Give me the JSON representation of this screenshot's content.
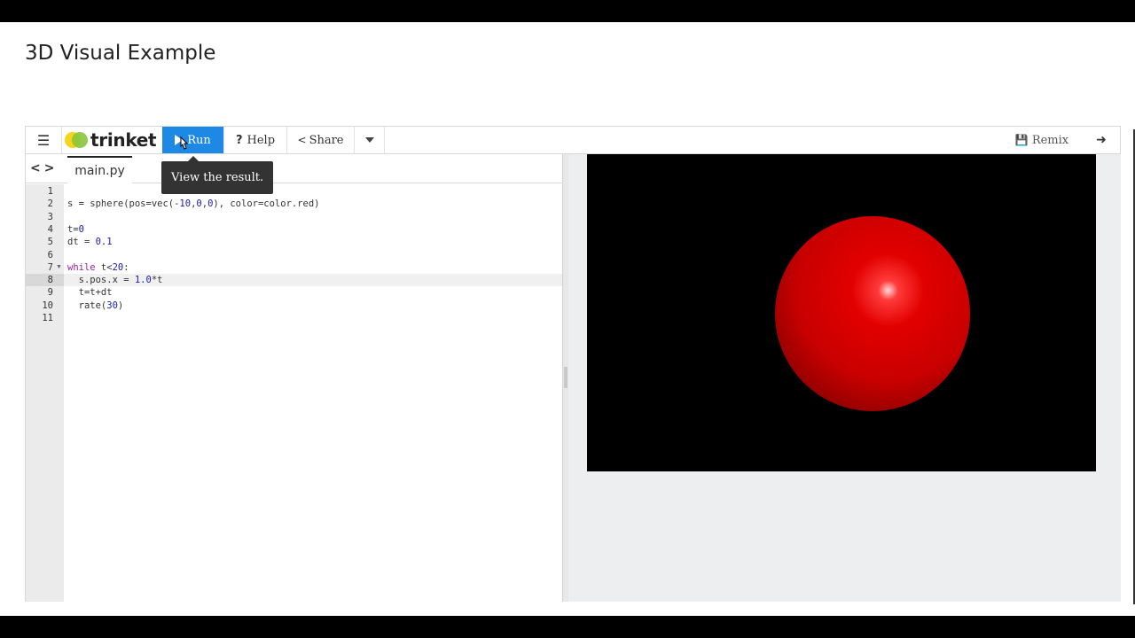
{
  "page": {
    "title": "3D Visual Example"
  },
  "toolbar": {
    "menu_icon": "hamburger-icon",
    "logo_text": "trinket",
    "run_label": "Run",
    "help_label": "Help",
    "share_label": "Share",
    "remix_label": "Remix",
    "run_color": "#1e88e5"
  },
  "tooltip": {
    "text": "View the result."
  },
  "editor": {
    "file_tab": "main.py",
    "active_line": 8,
    "lines": [
      {
        "n": "1",
        "text": ""
      },
      {
        "n": "2",
        "text": "s = sphere(pos=vec(-10,0,0), color=color.red)"
      },
      {
        "n": "3",
        "text": ""
      },
      {
        "n": "4",
        "text": "t=0"
      },
      {
        "n": "5",
        "text": "dt = 0.1"
      },
      {
        "n": "6",
        "text": ""
      },
      {
        "n": "7",
        "text": "while t<20:"
      },
      {
        "n": "8",
        "text": "  s.pos.x = 1.0*t"
      },
      {
        "n": "9",
        "text": "  t=t+dt"
      },
      {
        "n": "10",
        "text": "  rate(30)"
      },
      {
        "n": "11",
        "text": ""
      }
    ]
  },
  "output": {
    "background": "#000000",
    "sphere_color": "#e20000"
  }
}
